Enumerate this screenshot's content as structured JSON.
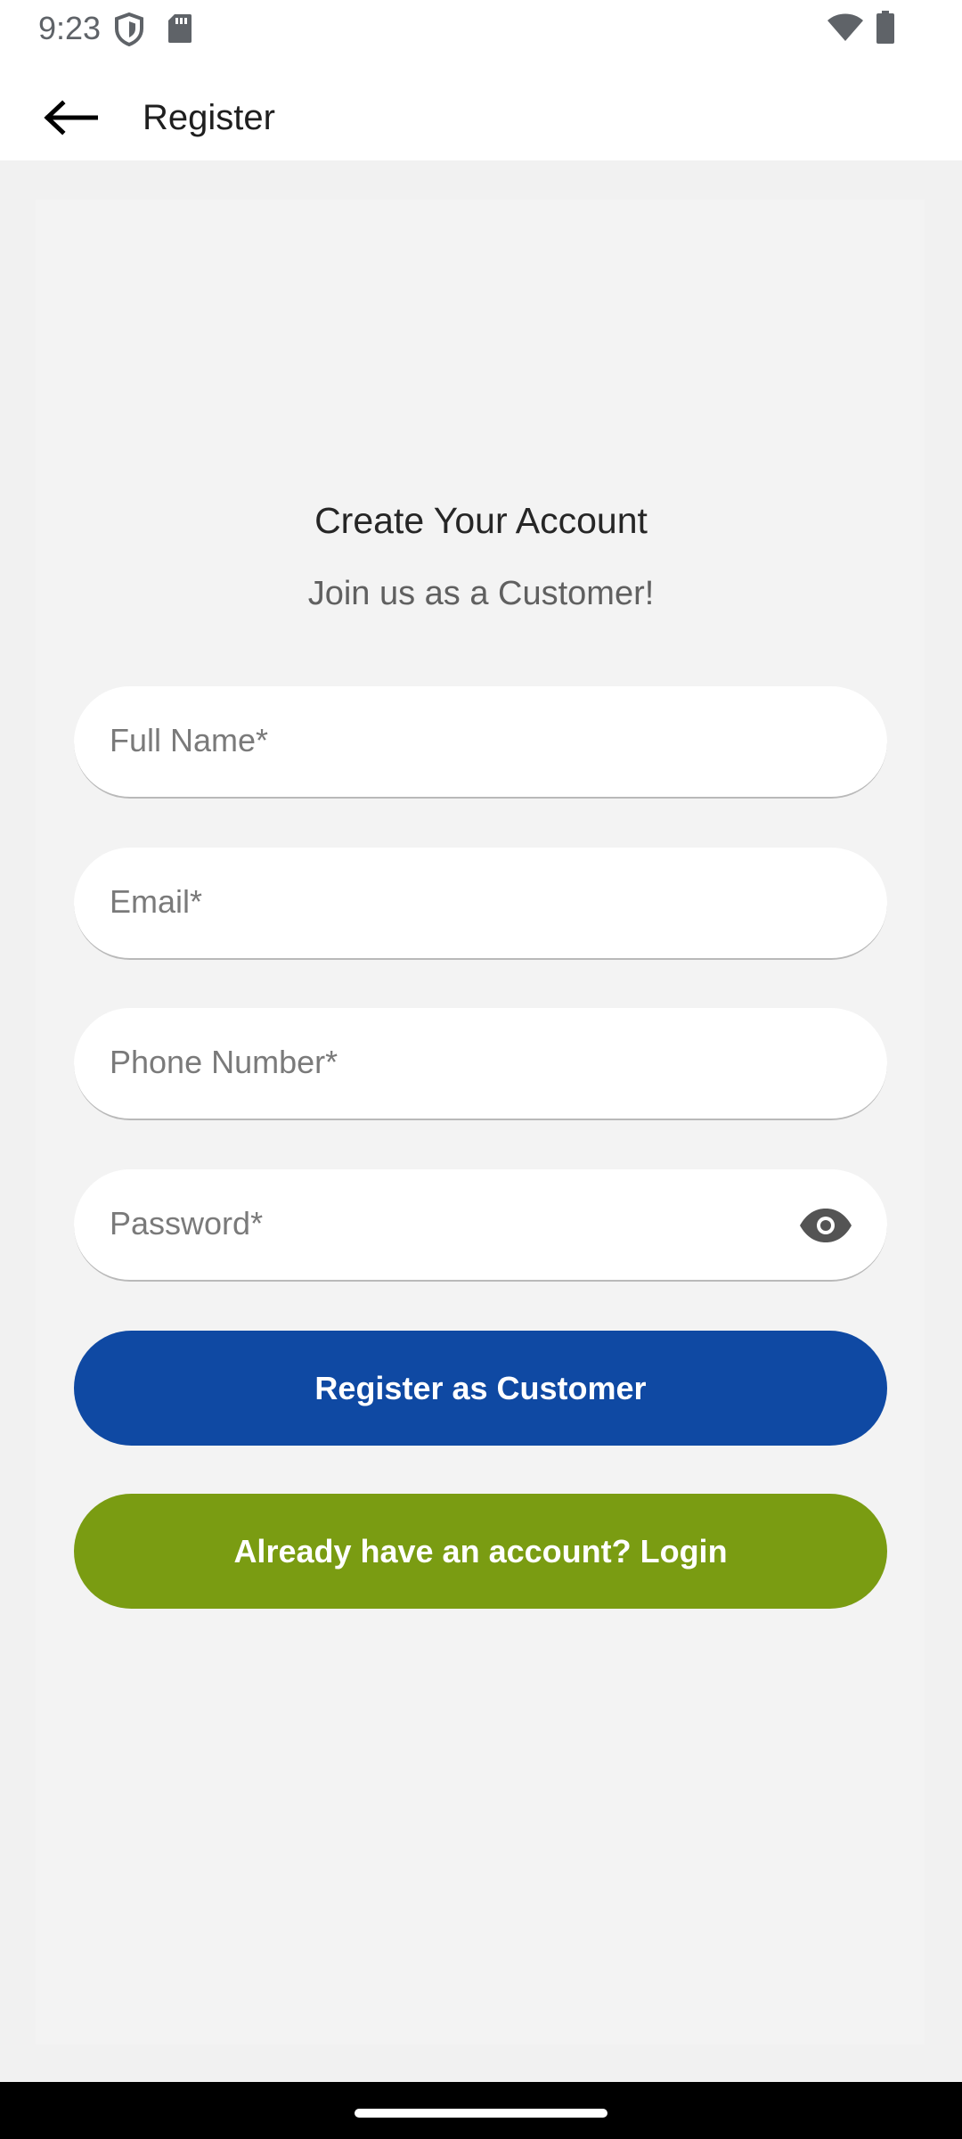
{
  "status_bar": {
    "time": "9:23",
    "icons": [
      "shield-icon",
      "sd-card-icon",
      "wifi-icon",
      "battery-icon"
    ]
  },
  "app_bar": {
    "title": "Register",
    "back_icon": "arrow-back-icon"
  },
  "form": {
    "heading": "Create Your Account",
    "subheading": "Join us as a Customer!",
    "full_name_placeholder": "Full Name*",
    "email_placeholder": "Email*",
    "phone_placeholder": "Phone Number*",
    "password_placeholder": "Password*",
    "password_toggle_icon": "eye-icon",
    "register_button": "Register as Customer",
    "login_button": "Already have an account? Login"
  },
  "colors": {
    "primary_button": "#0f49a3",
    "secondary_button": "#7a9c12",
    "background": "#f1f1f1"
  }
}
